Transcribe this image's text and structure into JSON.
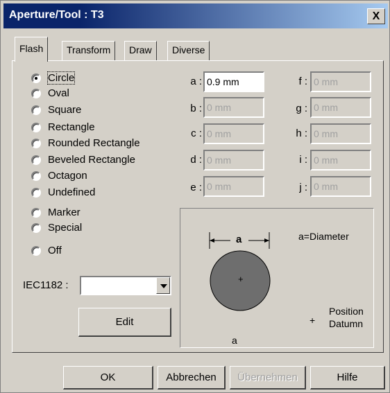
{
  "window": {
    "title": "Aperture/Tool : T3",
    "close_glyph": "X"
  },
  "tabs": [
    {
      "label": "Flash",
      "active": true
    },
    {
      "label": "Transform",
      "active": false
    },
    {
      "label": "Draw",
      "active": false
    },
    {
      "label": "Diverse",
      "active": false
    }
  ],
  "shapes": [
    {
      "label": "Circle",
      "checked": true
    },
    {
      "label": "Oval",
      "checked": false
    },
    {
      "label": "Square",
      "checked": false
    },
    {
      "label": "Rectangle",
      "checked": false
    },
    {
      "label": "Rounded Rectangle",
      "checked": false
    },
    {
      "label": "Beveled Rectangle",
      "checked": false
    },
    {
      "label": "Octagon",
      "checked": false
    },
    {
      "label": "Undefined",
      "checked": false
    },
    {
      "label": "Marker",
      "checked": false
    },
    {
      "label": "Special",
      "checked": false
    },
    {
      "label": "Off",
      "checked": false
    }
  ],
  "params": {
    "a": {
      "label": "a :",
      "value": "0.9 mm",
      "enabled": true
    },
    "b": {
      "label": "b :",
      "value": "0 mm",
      "enabled": false
    },
    "c": {
      "label": "c :",
      "value": "0 mm",
      "enabled": false
    },
    "d": {
      "label": "d :",
      "value": "0 mm",
      "enabled": false
    },
    "e": {
      "label": "e :",
      "value": "0 mm",
      "enabled": false
    },
    "f": {
      "label": "f :",
      "value": "0 mm",
      "enabled": false
    },
    "g": {
      "label": "g :",
      "value": "0 mm",
      "enabled": false
    },
    "h": {
      "label": "h :",
      "value": "0 mm",
      "enabled": false
    },
    "i": {
      "label": "i :",
      "value": "0 mm",
      "enabled": false
    },
    "j": {
      "label": "j :",
      "value": "0 mm",
      "enabled": false
    }
  },
  "iec": {
    "label": "IEC1182 :",
    "value": ""
  },
  "edit_button": "Edit",
  "diagram": {
    "dimension_label": "a",
    "legend": "a=Diameter",
    "center_mark": "+",
    "position_mark": "+",
    "position_line1": "Position",
    "position_line2": "Datumn",
    "caption": "a"
  },
  "footer": {
    "ok": "OK",
    "cancel": "Abbrechen",
    "apply": "Übernehmen",
    "help": "Hilfe"
  },
  "colors": {
    "title_start": "#0a246a",
    "title_end": "#a6caf0",
    "face": "#d4d0c8",
    "circle_fill": "#6e6e6e"
  }
}
